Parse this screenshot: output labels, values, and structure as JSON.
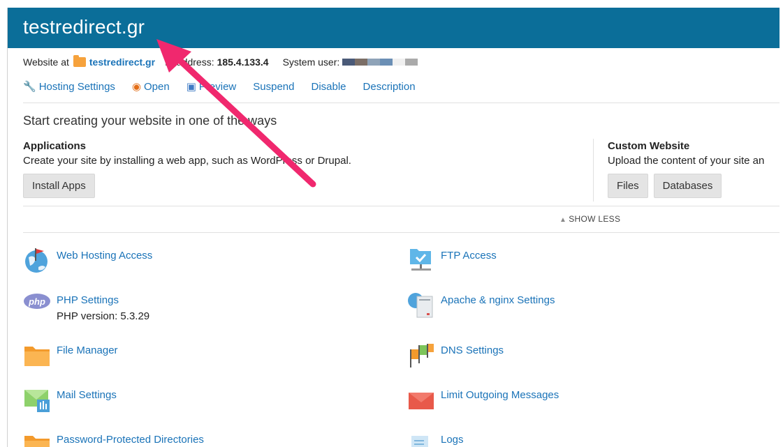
{
  "header": {
    "domain": "testredirect.gr"
  },
  "info": {
    "website_label": "Website at",
    "website_link": "testredirect.gr",
    "ip_label": "IP address:",
    "ip_value": "185.4.133.4",
    "system_user_label": "System user:",
    "user_redaction_colors": [
      "#4a5a78",
      "#7b6e66",
      "#8fa3b8",
      "#6b8fb5",
      "#f0f0f0",
      "#aaaaaa"
    ]
  },
  "actions": [
    {
      "label": "Hosting Settings",
      "icon": "tools-icon"
    },
    {
      "label": "Open",
      "icon": "open-globe-icon"
    },
    {
      "label": "Preview",
      "icon": "preview-icon"
    },
    {
      "label": "Suspend"
    },
    {
      "label": "Disable"
    },
    {
      "label": "Description"
    }
  ],
  "start_text": "Start creating your website in one of the ways",
  "applications": {
    "title": "Applications",
    "description": "Create your site by installing a web app, such as WordPress or Drupal.",
    "button": "Install Apps"
  },
  "custom_website": {
    "title": "Custom Website",
    "description": "Upload the content of your site an",
    "buttons": [
      "Files",
      "Databases"
    ]
  },
  "show_less": "SHOW LESS",
  "tools_left": [
    {
      "label": "Web Hosting Access",
      "icon": "globe-flag-icon"
    },
    {
      "label": "PHP Settings",
      "icon": "php-icon",
      "sub": "PHP version: 5.3.29"
    },
    {
      "label": "File Manager",
      "icon": "folder-icon"
    },
    {
      "label": "Mail Settings",
      "icon": "mail-settings-icon"
    },
    {
      "label": "Password-Protected Directories",
      "icon": "protected-folder-icon"
    }
  ],
  "tools_right": [
    {
      "label": "FTP Access",
      "icon": "ftp-folder-icon"
    },
    {
      "label": "Apache & nginx Settings",
      "icon": "server-globe-icon"
    },
    {
      "label": "DNS Settings",
      "icon": "dns-flags-icon"
    },
    {
      "label": "Limit Outgoing Messages",
      "icon": "envelope-icon"
    },
    {
      "label": "Logs",
      "icon": "logs-icon"
    }
  ],
  "colors": {
    "header_bg": "#0b6e99",
    "link": "#1a73b8",
    "annotation_arrow": "#f0286e",
    "folder_orange": "#f6a23c"
  }
}
